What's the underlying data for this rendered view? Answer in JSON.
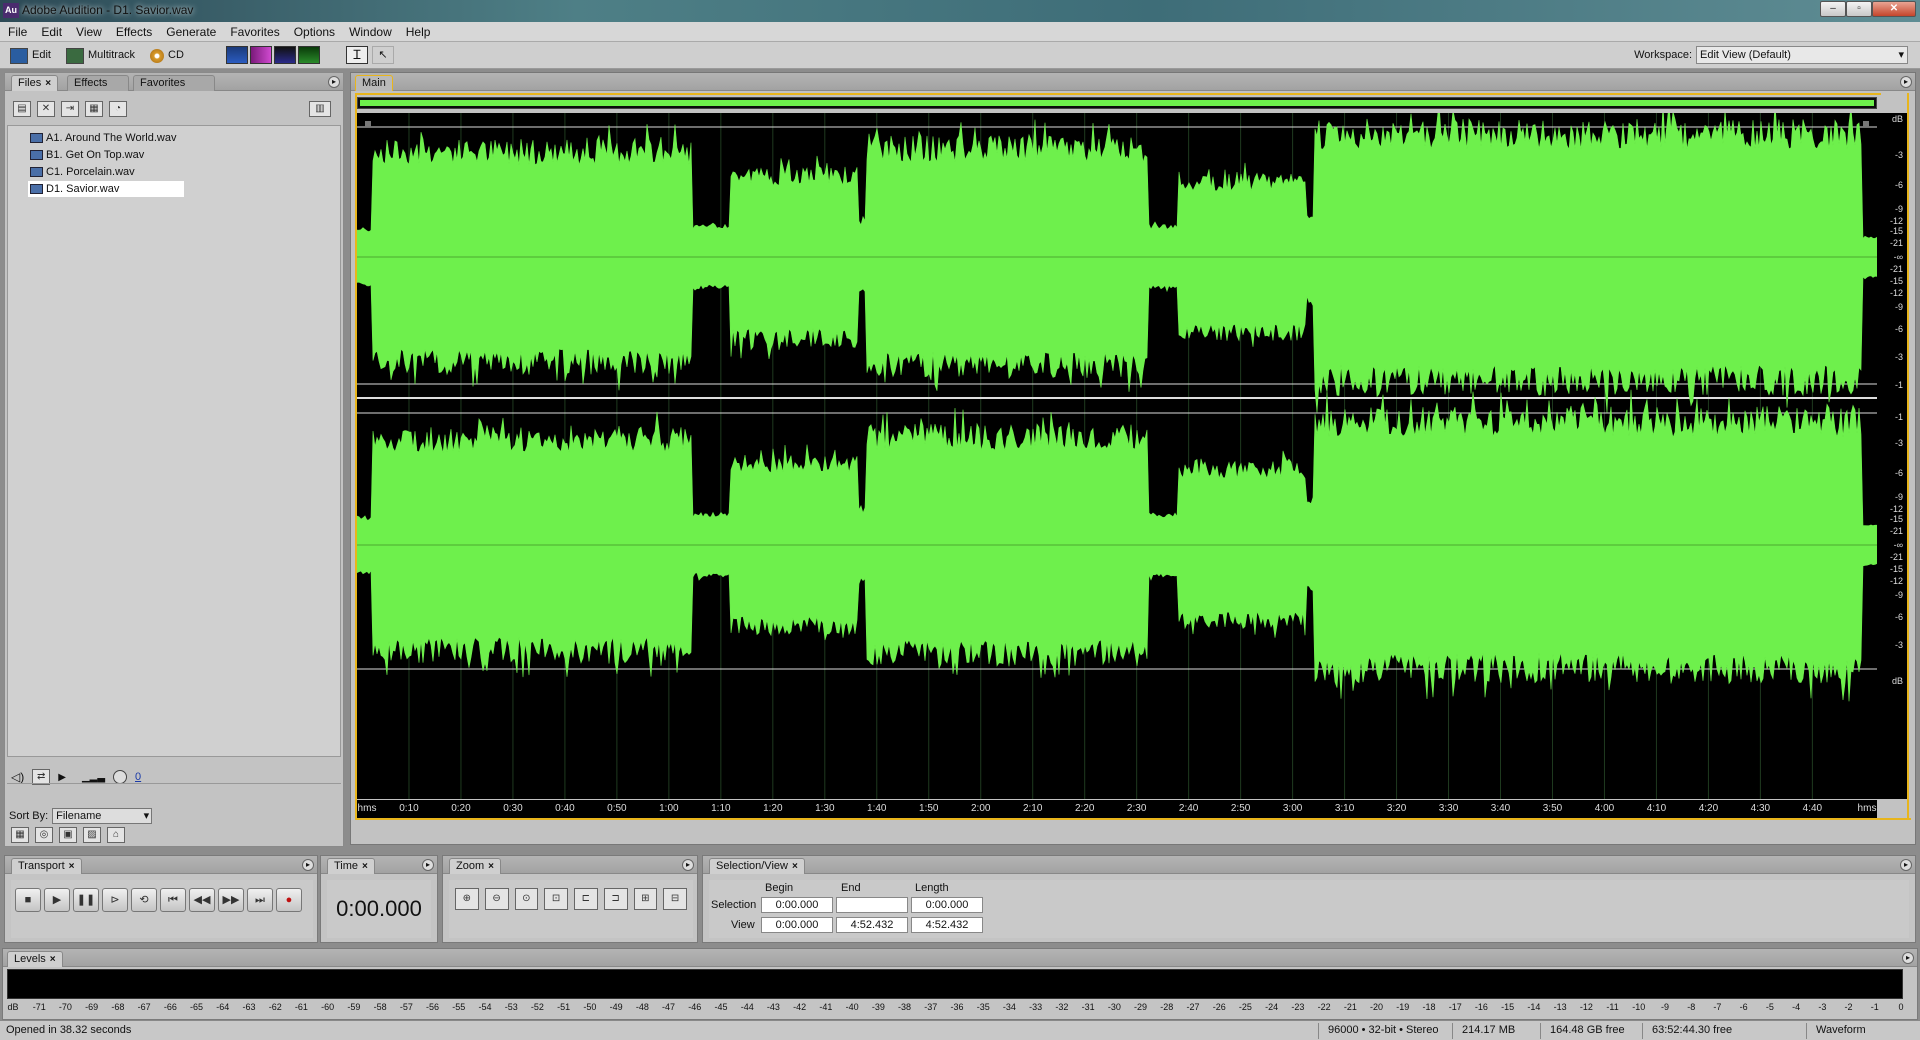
{
  "window": {
    "app_icon": "Au",
    "title": "Adobe Audition - D1. Savior.wav",
    "btn_min": "–",
    "btn_max": "▫",
    "btn_close": "✕"
  },
  "menu": [
    "File",
    "Edit",
    "View",
    "Effects",
    "Generate",
    "Favorites",
    "Options",
    "Window",
    "Help"
  ],
  "toolbar": {
    "edit": "Edit",
    "multitrack": "Multitrack",
    "cd": "CD",
    "workspace_label": "Workspace:",
    "workspace_value": "Edit View (Default)"
  },
  "files_panel": {
    "tabs": [
      "Files",
      "Effects",
      "Favorites"
    ],
    "files": [
      "A1. Around The World.wav",
      "B1. Get On Top.wav",
      "C1. Porcelain.wav",
      "D1. Savior.wav"
    ],
    "selected_index": 3,
    "volume_value": "0",
    "sort_label": "Sort By:",
    "sort_value": "Filename"
  },
  "editor": {
    "tab": "Main",
    "waveform_color": "#6ef04c",
    "ruler_unit": "hms",
    "ruler_labels": [
      "0:10",
      "0:20",
      "0:30",
      "0:40",
      "0:50",
      "1:00",
      "1:10",
      "1:20",
      "1:30",
      "1:40",
      "1:50",
      "2:00",
      "2:10",
      "2:20",
      "2:30",
      "2:40",
      "2:50",
      "3:00",
      "3:10",
      "3:20",
      "3:30",
      "3:40",
      "3:50",
      "4:00",
      "4:10",
      "4:20",
      "4:30",
      "4:40"
    ],
    "db_unit": "dB",
    "db_labels_ch1": [
      "-3",
      "-6",
      "-9",
      "-12",
      "-15",
      "-21",
      "-∞",
      "-21",
      "-15",
      "-12",
      "-9",
      "-6",
      "-3",
      "-1"
    ],
    "db_labels_ch2": [
      "-1",
      "-3",
      "-6",
      "-9",
      "-12",
      "-15",
      "-21",
      "-∞",
      "-21",
      "-15",
      "-12",
      "-9",
      "-6",
      "-3"
    ]
  },
  "transport": {
    "title": "Transport"
  },
  "time": {
    "title": "Time",
    "value": "0:00.000"
  },
  "zoom": {
    "title": "Zoom"
  },
  "selection_view": {
    "title": "Selection/View",
    "col_begin": "Begin",
    "col_end": "End",
    "col_length": "Length",
    "row_selection": "Selection",
    "row_view": "View",
    "sel_begin": "0:00.000",
    "sel_end": "",
    "sel_length": "0:00.000",
    "view_begin": "0:00.000",
    "view_end": "4:52.432",
    "view_length": "4:52.432"
  },
  "levels": {
    "title": "Levels",
    "scale": [
      "dB",
      "-71",
      "-70",
      "-69",
      "-68",
      "-67",
      "-66",
      "-65",
      "-64",
      "-63",
      "-62",
      "-61",
      "-60",
      "-59",
      "-58",
      "-57",
      "-56",
      "-55",
      "-54",
      "-53",
      "-52",
      "-51",
      "-50",
      "-49",
      "-48",
      "-47",
      "-46",
      "-45",
      "-44",
      "-43",
      "-42",
      "-41",
      "-40",
      "-39",
      "-38",
      "-37",
      "-36",
      "-35",
      "-34",
      "-33",
      "-32",
      "-31",
      "-30",
      "-29",
      "-28",
      "-27",
      "-26",
      "-25",
      "-24",
      "-23",
      "-22",
      "-21",
      "-20",
      "-19",
      "-18",
      "-17",
      "-16",
      "-15",
      "-14",
      "-13",
      "-12",
      "-11",
      "-10",
      "-9",
      "-8",
      "-7",
      "-6",
      "-5",
      "-4",
      "-3",
      "-2",
      "-1",
      "0"
    ]
  },
  "status": {
    "opened": "Opened in 38.32 seconds",
    "format": "96000 • 32-bit • Stereo",
    "size": "214.17 MB",
    "free": "164.48 GB free",
    "time_free": "63:52:44.30 free",
    "view": "Waveform"
  }
}
